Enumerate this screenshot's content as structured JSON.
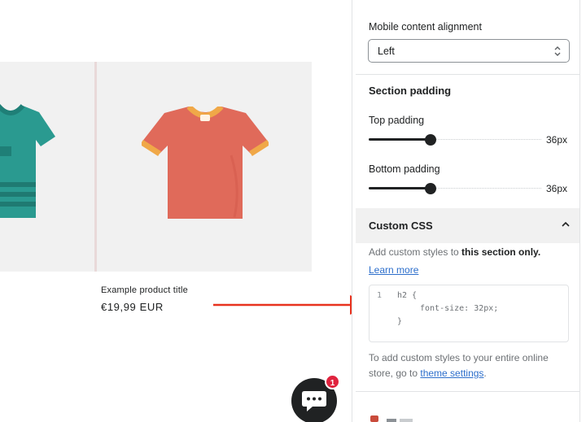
{
  "preview": {
    "product": {
      "title": "Example product title",
      "price": "€19,99 EUR"
    },
    "chat": {
      "badge_count": "1"
    }
  },
  "panel": {
    "mobile_alignment": {
      "label": "Mobile content alignment",
      "value": "Left"
    },
    "section_padding": {
      "heading": "Section padding",
      "top": {
        "label": "Top padding",
        "value": "36px",
        "fraction": 0.36
      },
      "bottom": {
        "label": "Bottom padding",
        "value": "36px",
        "fraction": 0.36
      }
    },
    "custom_css": {
      "heading": "Custom CSS",
      "help_prefix": "Add custom styles to ",
      "help_bold": "this section only.",
      "learn_more": "Learn more",
      "code": {
        "line_number": "1",
        "lines": [
          "h2 {",
          "font-size: 32px;",
          "}"
        ]
      },
      "footer_prefix": "To add custom styles to your entire online store, go to ",
      "footer_link": "theme settings",
      "footer_suffix": "."
    }
  },
  "colors": {
    "arrow": "#e8321e",
    "shirt_teal": "#2a9a90",
    "shirt_coral": "#e06a5a",
    "shirt_collar": "#f0a848",
    "link": "#2c6ecb"
  },
  "icons": [
    "chevron-updown-icon",
    "chevron-up-icon",
    "chat-bubble-icon",
    "arrow-icon"
  ]
}
